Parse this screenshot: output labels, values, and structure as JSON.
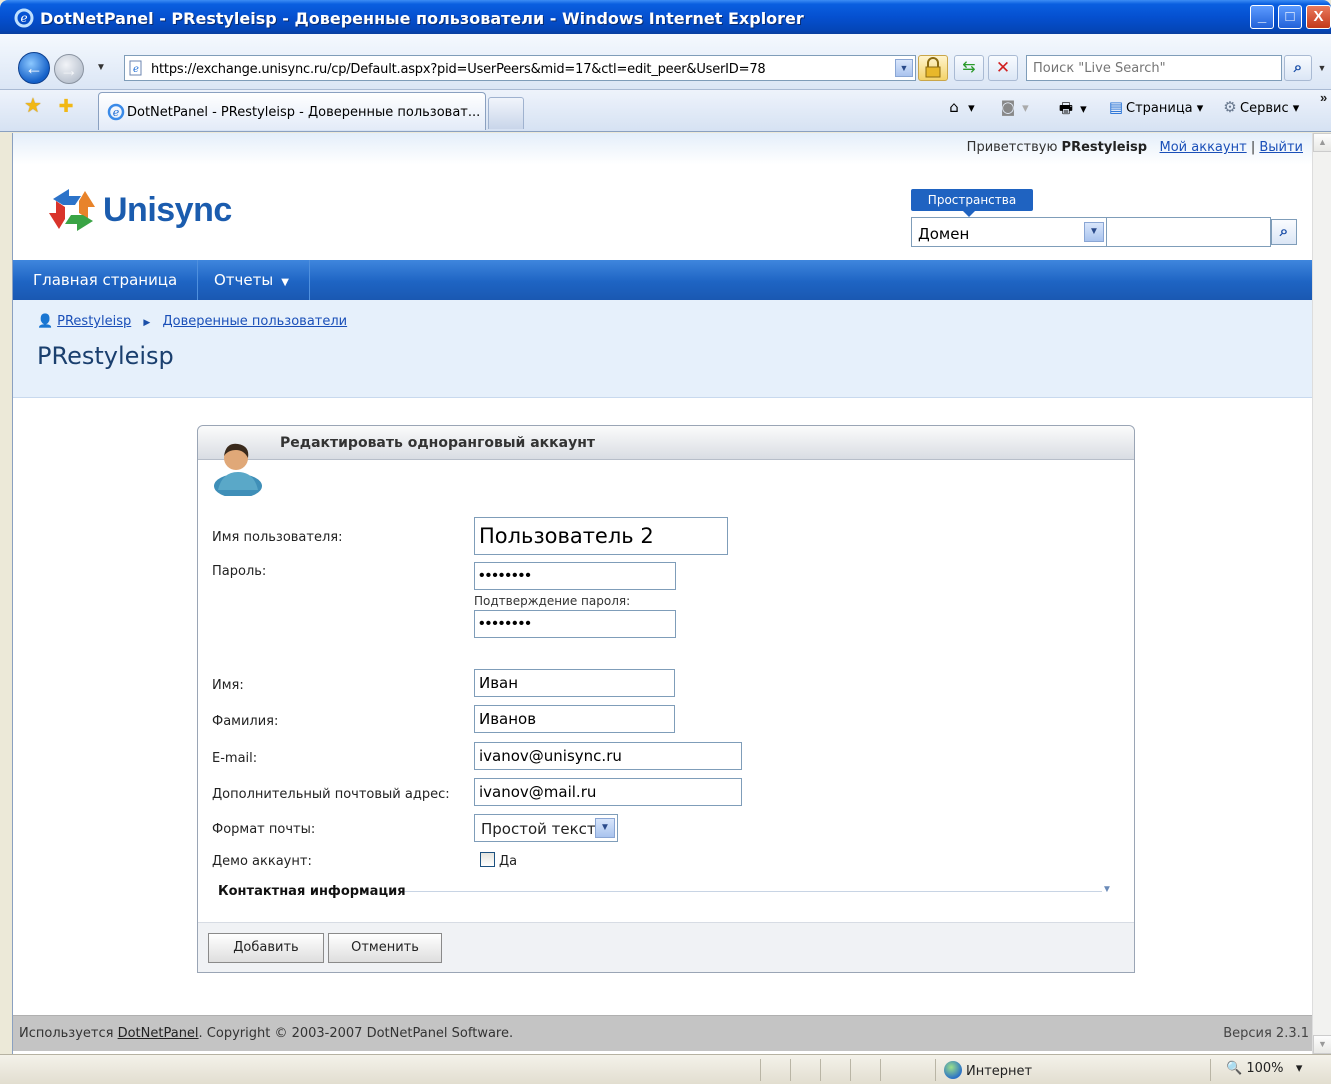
{
  "window": {
    "title": "DotNetPanel - PRestyleisp - Доверенные пользователи - Windows Internet Explorer",
    "minimize": "_",
    "maximize": "□",
    "close": "X"
  },
  "browser": {
    "url": "https://exchange.unisync.ru/cp/Default.aspx?pid=UserPeers&mid=17&ctl=edit_peer&UserID=78",
    "search_placeholder": "Поиск \"Live Search\"",
    "tab_label": "DotNetPanel - PRestyleisp - Доверенные пользоват...",
    "commands": {
      "page": "Страница",
      "tools": "Сервис"
    },
    "icons": [
      "back-icon",
      "forward-icon",
      "lock-icon",
      "refresh-icon",
      "stop-icon",
      "search-icon",
      "favorites-star-icon",
      "add-favorites-icon",
      "home-icon",
      "rss-icon",
      "print-icon",
      "page-icon",
      "tools-gear-icon"
    ]
  },
  "header": {
    "greeting_prefix": "Приветствую",
    "username": "PRestyleisp",
    "my_account": "Мой аккаунт",
    "logout": "Выйти",
    "separator": "|",
    "logo_text": "Unisync",
    "spaces_label": "Пространства",
    "domain_select": "Домен"
  },
  "menu": {
    "home": "Главная страница",
    "reports": "Отчеты"
  },
  "breadcrumb": {
    "user": "PRestyleisp",
    "section": "Доверенные пользователи"
  },
  "page_title": "PRestyleisp",
  "form": {
    "title": "Редактировать одноранговый аккаунт",
    "username_label": "Имя пользователя:",
    "username_value": "Пользователь 2",
    "password_label": "Пароль:",
    "password_value": "••••••••",
    "confirm_label": "Подтверждение пароля:",
    "confirm_value": "••••••••",
    "first_name_label": "Имя:",
    "first_name_value": "Иван",
    "last_name_label": "Фамилия:",
    "last_name_value": "Иванов",
    "email_label": "E-mail:",
    "email_value": "ivanov@unisync.ru",
    "secondary_email_label": "Дополнительный почтовый адрес:",
    "secondary_email_value": "ivanov@mail.ru",
    "mail_format_label": "Формат почты:",
    "mail_format_value": "Простой текст",
    "demo_label": "Демо аккаунт:",
    "demo_checkbox_label": "Да",
    "contact_section": "Контактная информация",
    "add_button": "Добавить",
    "cancel_button": "Отменить"
  },
  "footer": {
    "prefix": "Используется",
    "link": "DotNetPanel",
    "suffix": ". Copyright © 2003-2007 DotNetPanel Software.",
    "version": "Версия 2.3.1"
  },
  "status": {
    "zone": "Интернет",
    "zoom": "100%"
  },
  "colors": {
    "menu_blue": "#1e64c3",
    "link_blue": "#1a4fb8",
    "xp_title": "#0550d0"
  }
}
